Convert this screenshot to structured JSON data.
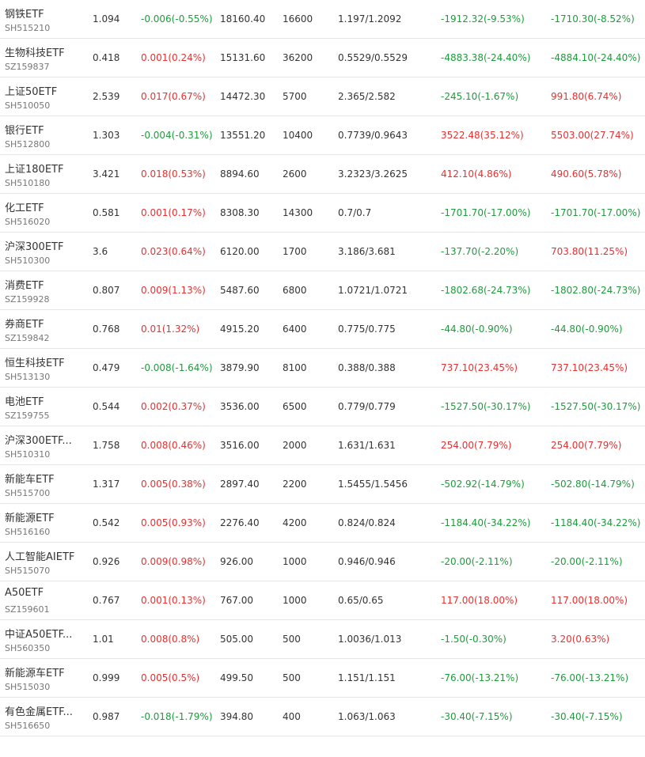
{
  "colors": {
    "up": "#e93030",
    "down": "#1e9c3c",
    "text": "#333333",
    "subtext": "#777777",
    "divider": "#e6e6e6"
  },
  "holdings": [
    {
      "name": "钢铁ETF",
      "code": "SH515210",
      "price": "1.094",
      "change": "-0.006(-0.55%)",
      "change_dir": "down",
      "market_value": "18160.40",
      "quantity": "16600",
      "cost": "1.197/1.2092",
      "pnl1": "-1912.32(-9.53%)",
      "pnl1_dir": "down",
      "pnl2": "-1710.30(-8.52%)",
      "pnl2_dir": "down"
    },
    {
      "name": "生物科技ETF",
      "code": "SZ159837",
      "price": "0.418",
      "change": "0.001(0.24%)",
      "change_dir": "up",
      "market_value": "15131.60",
      "quantity": "36200",
      "cost": "0.5529/0.5529",
      "pnl1": "-4883.38(-24.40%)",
      "pnl1_dir": "down",
      "pnl2": "-4884.10(-24.40%)",
      "pnl2_dir": "down"
    },
    {
      "name": "上证50ETF",
      "code": "SH510050",
      "price": "2.539",
      "change": "0.017(0.67%)",
      "change_dir": "up",
      "market_value": "14472.30",
      "quantity": "5700",
      "cost": "2.365/2.582",
      "pnl1": "-245.10(-1.67%)",
      "pnl1_dir": "down",
      "pnl2": "991.80(6.74%)",
      "pnl2_dir": "up"
    },
    {
      "name": "银行ETF",
      "code": "SH512800",
      "price": "1.303",
      "change": "-0.004(-0.31%)",
      "change_dir": "down",
      "market_value": "13551.20",
      "quantity": "10400",
      "cost": "0.7739/0.9643",
      "pnl1": "3522.48(35.12%)",
      "pnl1_dir": "up",
      "pnl2": "5503.00(27.74%)",
      "pnl2_dir": "up"
    },
    {
      "name": "上证180ETF",
      "code": "SH510180",
      "price": "3.421",
      "change": "0.018(0.53%)",
      "change_dir": "up",
      "market_value": "8894.60",
      "quantity": "2600",
      "cost": "3.2323/3.2625",
      "pnl1": "412.10(4.86%)",
      "pnl1_dir": "up",
      "pnl2": "490.60(5.78%)",
      "pnl2_dir": "up"
    },
    {
      "name": "化工ETF",
      "code": "SH516020",
      "price": "0.581",
      "change": "0.001(0.17%)",
      "change_dir": "up",
      "market_value": "8308.30",
      "quantity": "14300",
      "cost": "0.7/0.7",
      "pnl1": "-1701.70(-17.00%)",
      "pnl1_dir": "down",
      "pnl2": "-1701.70(-17.00%)",
      "pnl2_dir": "down"
    },
    {
      "name": "沪深300ETF",
      "code": "SH510300",
      "price": "3.6",
      "change": "0.023(0.64%)",
      "change_dir": "up",
      "market_value": "6120.00",
      "quantity": "1700",
      "cost": "3.186/3.681",
      "pnl1": "-137.70(-2.20%)",
      "pnl1_dir": "down",
      "pnl2": "703.80(11.25%)",
      "pnl2_dir": "up"
    },
    {
      "name": "消费ETF",
      "code": "SZ159928",
      "price": "0.807",
      "change": "0.009(1.13%)",
      "change_dir": "up",
      "market_value": "5487.60",
      "quantity": "6800",
      "cost": "1.0721/1.0721",
      "pnl1": "-1802.68(-24.73%)",
      "pnl1_dir": "down",
      "pnl2": "-1802.80(-24.73%)",
      "pnl2_dir": "down"
    },
    {
      "name": "券商ETF",
      "code": "SZ159842",
      "price": "0.768",
      "change": "0.01(1.32%)",
      "change_dir": "up",
      "market_value": "4915.20",
      "quantity": "6400",
      "cost": "0.775/0.775",
      "pnl1": "-44.80(-0.90%)",
      "pnl1_dir": "down",
      "pnl2": "-44.80(-0.90%)",
      "pnl2_dir": "down"
    },
    {
      "name": "恒生科技ETF",
      "code": "SH513130",
      "price": "0.479",
      "change": "-0.008(-1.64%)",
      "change_dir": "down",
      "market_value": "3879.90",
      "quantity": "8100",
      "cost": "0.388/0.388",
      "pnl1": "737.10(23.45%)",
      "pnl1_dir": "up",
      "pnl2": "737.10(23.45%)",
      "pnl2_dir": "up"
    },
    {
      "name": "电池ETF",
      "code": "SZ159755",
      "price": "0.544",
      "change": "0.002(0.37%)",
      "change_dir": "up",
      "market_value": "3536.00",
      "quantity": "6500",
      "cost": "0.779/0.779",
      "pnl1": "-1527.50(-30.17%)",
      "pnl1_dir": "down",
      "pnl2": "-1527.50(-30.17%)",
      "pnl2_dir": "down"
    },
    {
      "name": "沪深300ETF...",
      "code": "SH510310",
      "price": "1.758",
      "change": "0.008(0.46%)",
      "change_dir": "up",
      "market_value": "3516.00",
      "quantity": "2000",
      "cost": "1.631/1.631",
      "pnl1": "254.00(7.79%)",
      "pnl1_dir": "up",
      "pnl2": "254.00(7.79%)",
      "pnl2_dir": "up"
    },
    {
      "name": "新能车ETF",
      "code": "SH515700",
      "price": "1.317",
      "change": "0.005(0.38%)",
      "change_dir": "up",
      "market_value": "2897.40",
      "quantity": "2200",
      "cost": "1.5455/1.5456",
      "pnl1": "-502.92(-14.79%)",
      "pnl1_dir": "down",
      "pnl2": "-502.80(-14.79%)",
      "pnl2_dir": "down"
    },
    {
      "name": "新能源ETF",
      "code": "SH516160",
      "price": "0.542",
      "change": "0.005(0.93%)",
      "change_dir": "up",
      "market_value": "2276.40",
      "quantity": "4200",
      "cost": "0.824/0.824",
      "pnl1": "-1184.40(-34.22%)",
      "pnl1_dir": "down",
      "pnl2": "-1184.40(-34.22%)",
      "pnl2_dir": "down"
    },
    {
      "name": "人工智能AIETF",
      "code": "SH515070",
      "price": "0.926",
      "change": "0.009(0.98%)",
      "change_dir": "up",
      "market_value": "926.00",
      "quantity": "1000",
      "cost": "0.946/0.946",
      "pnl1": "-20.00(-2.11%)",
      "pnl1_dir": "down",
      "pnl2": "-20.00(-2.11%)",
      "pnl2_dir": "down"
    },
    {
      "name": "A50ETF",
      "code": "SZ159601",
      "price": "0.767",
      "change": "0.001(0.13%)",
      "change_dir": "up",
      "market_value": "767.00",
      "quantity": "1000",
      "cost": "0.65/0.65",
      "pnl1": "117.00(18.00%)",
      "pnl1_dir": "up",
      "pnl2": "117.00(18.00%)",
      "pnl2_dir": "up"
    },
    {
      "name": "中证A50ETF...",
      "code": "SH560350",
      "price": "1.01",
      "change": "0.008(0.8%)",
      "change_dir": "up",
      "market_value": "505.00",
      "quantity": "500",
      "cost": "1.0036/1.013",
      "pnl1": "-1.50(-0.30%)",
      "pnl1_dir": "down",
      "pnl2": "3.20(0.63%)",
      "pnl2_dir": "up"
    },
    {
      "name": "新能源车ETF",
      "code": "SH515030",
      "price": "0.999",
      "change": "0.005(0.5%)",
      "change_dir": "up",
      "market_value": "499.50",
      "quantity": "500",
      "cost": "1.151/1.151",
      "pnl1": "-76.00(-13.21%)",
      "pnl1_dir": "down",
      "pnl2": "-76.00(-13.21%)",
      "pnl2_dir": "down"
    },
    {
      "name": "有色金属ETF...",
      "code": "SH516650",
      "price": "0.987",
      "change": "-0.018(-1.79%)",
      "change_dir": "down",
      "market_value": "394.80",
      "quantity": "400",
      "cost": "1.063/1.063",
      "pnl1": "-30.40(-7.15%)",
      "pnl1_dir": "down",
      "pnl2": "-30.40(-7.15%)",
      "pnl2_dir": "down"
    }
  ]
}
